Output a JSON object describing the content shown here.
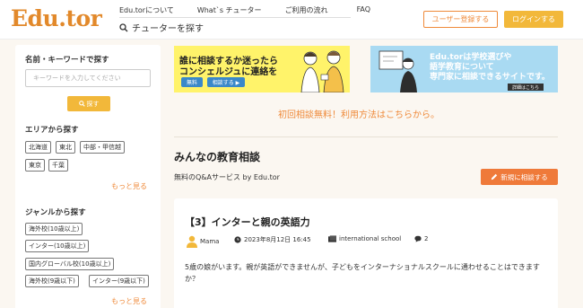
{
  "header": {
    "logo": "Edu.tor",
    "nav": [
      "Edu.torについて",
      "What`s チューター",
      "ご利用の流れ",
      "FAQ"
    ],
    "find_tutor": "チューターを探す",
    "register": "ユーザー登録する",
    "login": "ログインする"
  },
  "sidebar": {
    "keyword_title": "名前・キーワードで探す",
    "keyword_placeholder": "キーワードを入力してください",
    "search_button": "探す",
    "area_title": "エリアから探す",
    "areas": [
      "北海道",
      "東北",
      "中部・甲信越",
      "東京",
      "千葉"
    ],
    "more": "もっと見る",
    "genre_title": "ジャンルから探す",
    "genres": [
      "海外校(10歳以上)",
      "インター(10歳以上)",
      "国内グローバル校(10歳以上)",
      "海外校(9歳以下)",
      "インター(9歳以下)"
    ]
  },
  "banners": {
    "left": {
      "line1": "誰に相談するか迷ったら",
      "line2": "コンシェルジュに連絡を",
      "chip1": "無料",
      "chip2": "相談する ▶"
    },
    "right": {
      "line1": "Edu.torは学校選びや",
      "line2": "語学教育について",
      "line3": "専門家に相談できるサイトです。",
      "detail": "詳細はこちら"
    }
  },
  "main": {
    "free_link": "初回相談無料！利用方法はこちらから。",
    "title": "みんなの教育相談",
    "subtitle": "無料のQ&Aサービス by Edu.tor",
    "new_button": "新規に相談する"
  },
  "post": {
    "title": "【3】インターと親の英語力",
    "author": "Mama",
    "date": "2023年8月12日 16:45",
    "category": "international school",
    "comments": "2",
    "body": "5歳の娘がいます。親が英語ができませんが、子どもをインターナショナルスクールに通わせることはできますか？"
  },
  "colors": {
    "accent": "#ef8a3a",
    "yellow": "#f2b83a",
    "background": "#fbf7f1"
  }
}
